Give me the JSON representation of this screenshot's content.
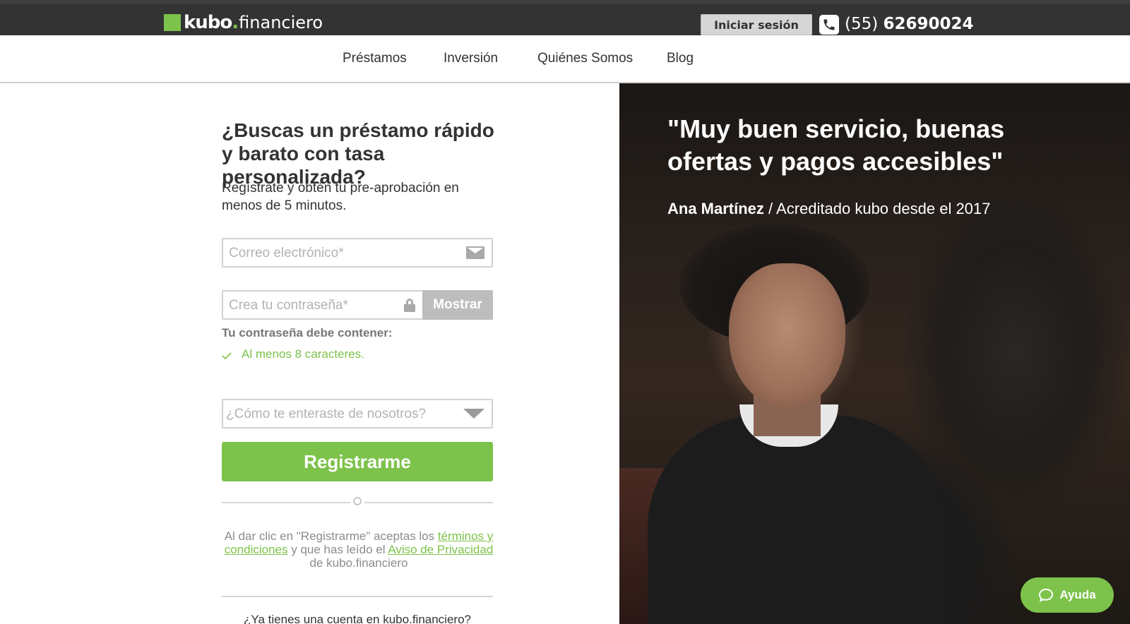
{
  "header": {
    "logo_main": "kubo",
    "logo_dot": ".",
    "logo_sub": "financiero",
    "login_label": "Iniciar sesión",
    "phone_area": "(55)",
    "phone_number": "62690024"
  },
  "nav": {
    "items": [
      "Préstamos",
      "Inversión",
      "Quiénes Somos",
      "Blog"
    ]
  },
  "form": {
    "headline": "¿Buscas un préstamo rápido y barato con tasa personalizada?",
    "subtitle": "Regístrate y obtén tu pre-aprobación en menos de 5 minutos.",
    "email_placeholder": "Correo electrónico*",
    "password_placeholder": "Crea tu contraseña*",
    "show_label": "Mostrar",
    "requirements_title": "Tu contraseña debe contener:",
    "requirement_1": "Al menos 8 caracteres.",
    "source_placeholder": "¿Cómo te enteraste de nosotros?",
    "submit_label": "Registrarme",
    "terms_prefix": "Al dar clic en \"Registrarme\" aceptas los ",
    "terms_link": "términos y condiciones",
    "terms_mid": " y que has leído el ",
    "privacy_link": "Aviso de Privacidad",
    "terms_suffix": " de kubo.financiero",
    "have_account": "¿Ya tienes una cuenta en kubo.financiero?"
  },
  "testimonial": {
    "quote": "\"Muy buen servicio, buenas ofertas y pagos accesibles\"",
    "name": "Ana Martínez",
    "detail": " / Acreditado kubo desde el 2017"
  },
  "help": {
    "label": "Ayuda"
  },
  "colors": {
    "brand_green": "#7dc24b",
    "topbar": "#333333"
  },
  "icons": [
    "phone-icon",
    "email-icon",
    "lock-icon",
    "check-icon",
    "dropdown-arrow-icon",
    "chat-icon"
  ]
}
